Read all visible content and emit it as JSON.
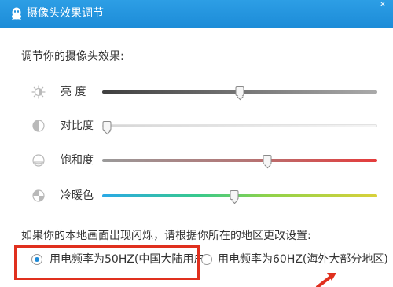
{
  "window": {
    "title": "摄像头效果调节",
    "close_icon": "close-icon"
  },
  "main": {
    "section_label": "调节你的摄像头效果:",
    "settings": [
      {
        "key": "brightness",
        "label": "亮    度",
        "icon": "brightness-icon",
        "value": 0.5
      },
      {
        "key": "contrast",
        "label": "对比度",
        "icon": "contrast-icon",
        "value": 0.0
      },
      {
        "key": "saturation",
        "label": "饱和度",
        "icon": "saturation-icon",
        "value": 0.6
      },
      {
        "key": "warmth",
        "label": "冷暖色",
        "icon": "warmth-icon",
        "value": 0.48
      }
    ],
    "frequency": {
      "label": "如果你的本地画面出现闪烁，请根据你所在的地区更改设置:",
      "options": [
        {
          "label": "用电频率为50HZ(中国大陆用户)",
          "selected": true
        },
        {
          "label": "用电频率为60HZ(海外大部分地区)",
          "selected": false
        }
      ]
    }
  },
  "colors": {
    "titlebar": "#1f90dc",
    "accent": "#1e8ad6",
    "highlight": "#e0301e"
  }
}
